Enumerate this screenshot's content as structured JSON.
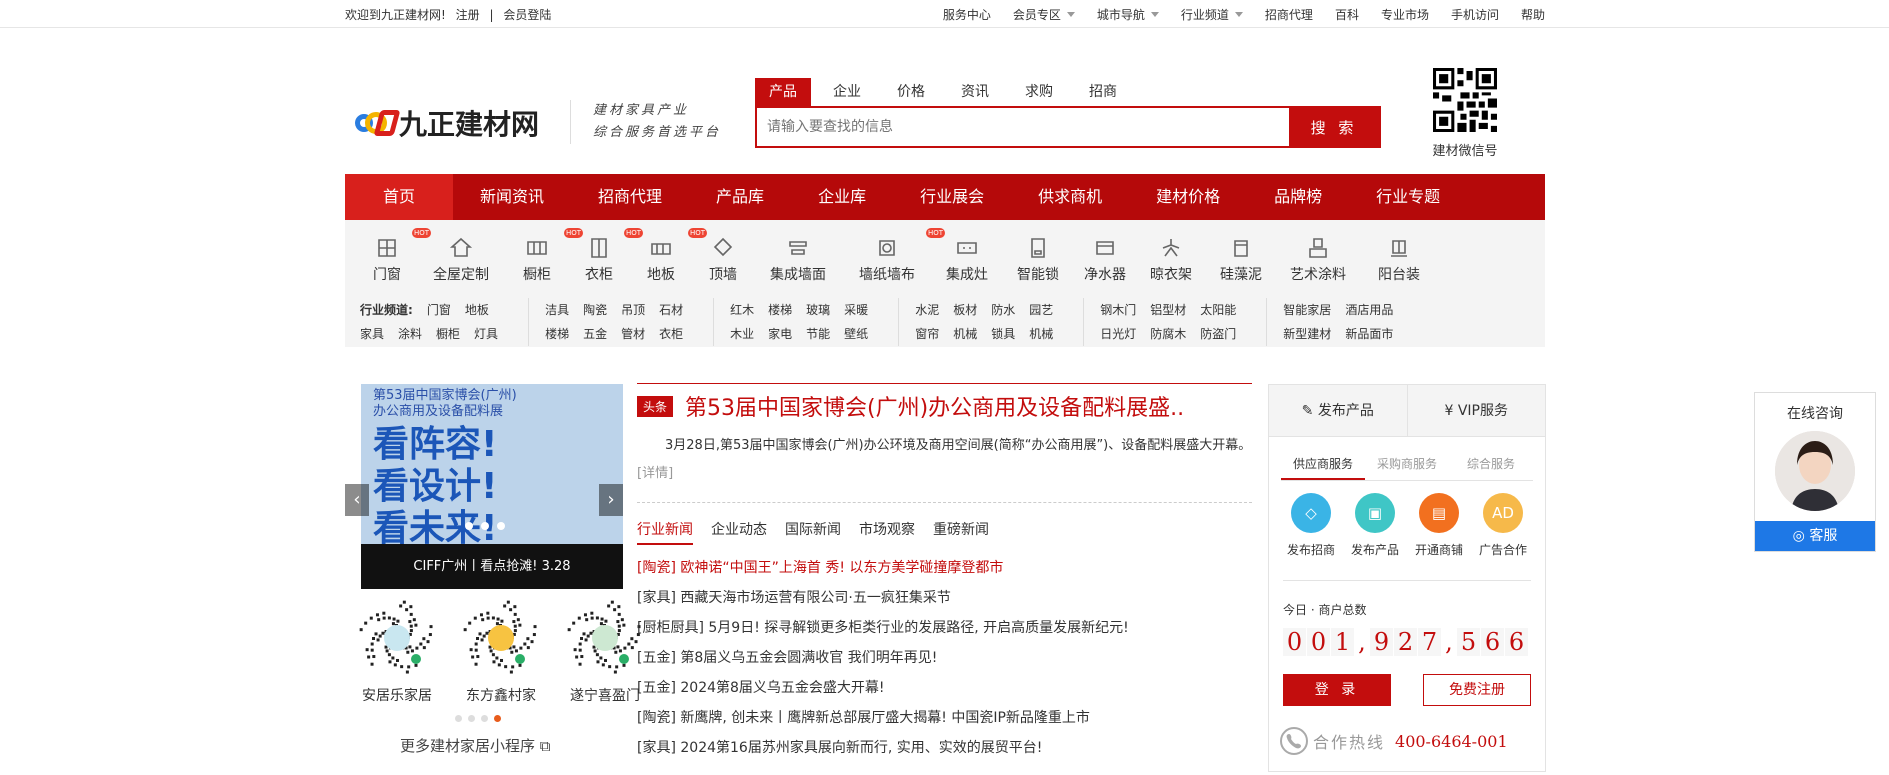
{
  "topbar": {
    "welcome": "欢迎到九正建材网!",
    "register": "注册",
    "login": "会员登陆",
    "links": [
      {
        "label": "服务中心",
        "caret": false
      },
      {
        "label": "会员专区",
        "caret": true
      },
      {
        "label": "城市导航",
        "caret": true
      },
      {
        "label": "行业频道",
        "caret": true
      },
      {
        "label": "招商代理",
        "caret": false
      },
      {
        "label": "百科",
        "caret": false
      },
      {
        "label": "专业市场",
        "caret": false
      },
      {
        "label": "手机访问",
        "caret": false
      },
      {
        "label": "帮助",
        "caret": false
      }
    ]
  },
  "header": {
    "logo": "九正建材网",
    "slogan1": "建材家具产业",
    "slogan2": "综合服务首选平台",
    "qr_label": "建材微信号"
  },
  "search": {
    "tabs": [
      "产品",
      "企业",
      "价格",
      "资讯",
      "求购",
      "招商"
    ],
    "placeholder": "请输入要查找的信息",
    "button": "搜 索"
  },
  "nav": [
    "首页",
    "新闻资讯",
    "招商代理",
    "产品库",
    "企业库",
    "行业展会",
    "供求商机",
    "建材价格",
    "品牌榜",
    "行业专题"
  ],
  "categories": [
    {
      "label": "门窗",
      "hot": true
    },
    {
      "label": "全屋定制",
      "hot": false
    },
    {
      "label": "橱柜",
      "hot": true
    },
    {
      "label": "衣柜",
      "hot": true
    },
    {
      "label": "地板",
      "hot": true
    },
    {
      "label": "顶墙",
      "hot": false
    },
    {
      "label": "集成墙面",
      "hot": false
    },
    {
      "label": "墙纸墙布",
      "hot": true
    },
    {
      "label": "集成灶",
      "hot": false
    },
    {
      "label": "智能锁",
      "hot": false
    },
    {
      "label": "净水器",
      "hot": false
    },
    {
      "label": "晾衣架",
      "hot": false
    },
    {
      "label": "硅藻泥",
      "hot": false
    },
    {
      "label": "艺术涂料",
      "hot": false
    },
    {
      "label": "阳台装",
      "hot": false
    }
  ],
  "hot_label": "HOT",
  "channels": {
    "title": "行业频道:",
    "groups": [
      {
        "r1": [
          "门窗",
          "地板"
        ],
        "r2": [
          "家具",
          "涂料",
          "橱柜",
          "灯具"
        ]
      },
      {
        "r1": [
          "洁具",
          "陶瓷",
          "吊顶",
          "石材"
        ],
        "r2": [
          "楼梯",
          "五金",
          "管材",
          "衣柜"
        ]
      },
      {
        "r1": [
          "红木",
          "楼梯",
          "玻璃",
          "采暖"
        ],
        "r2": [
          "木业",
          "家电",
          "节能",
          "壁纸"
        ]
      },
      {
        "r1": [
          "水泥",
          "板材",
          "防水",
          "园艺"
        ],
        "r2": [
          "窗帘",
          "机械",
          "锁具",
          "机械"
        ]
      },
      {
        "r1": [
          "钢木门",
          "铝型材",
          "太阳能"
        ],
        "r2": [
          "日光灯",
          "防腐木",
          "防盗门"
        ]
      },
      {
        "r1": [
          "智能家居",
          "酒店用品"
        ],
        "r2": [
          "新型建材",
          "新品面市"
        ]
      }
    ]
  },
  "banner": {
    "title1": "第53届中国家博会(广州)",
    "title2": "办公商用及设备配料展",
    "big1": "看阵容!",
    "big2": "看设计!",
    "big3": "看未来!",
    "caption": "CIFF广州丨看点抢滩! 3.28",
    "prev": "‹",
    "next": "›"
  },
  "miniprograms": [
    {
      "name": "安居乐家居"
    },
    {
      "name": "东方鑫村家"
    },
    {
      "name": "遂宁喜盈门"
    }
  ],
  "more_mp": "更多建材家居小程序 ⧉",
  "headline": {
    "tag": "头条",
    "title": "第53届中国家博会(广州)办公商用及设备配料展盛..",
    "summary": "3月28日,第53届中国家博会(广州)办公环境及商用空间展(简称“办公商用展”)、设备配料展盛大开幕。",
    "detail": "[详情]"
  },
  "news_tabs": [
    "行业新闻",
    "企业动态",
    "国际新闻",
    "市场观察",
    "重磅新闻"
  ],
  "news": [
    {
      "text": "[陶瓷] 欧神诺“中国王”上海首 秀! 以东方美学碰撞摩登都市",
      "red": true
    },
    {
      "text": "[家具] 西藏天海市场运营有限公司·五一疯狂集采节",
      "red": false
    },
    {
      "text": "[厨柜厨具] 5月9日! 探寻解锁更多柜类行业的发展路径, 开启高质量发展新纪元!",
      "red": false
    },
    {
      "text": "[五金] 第8届义乌五金会圆满收官 我们明年再见!",
      "red": false
    },
    {
      "text": "[五金] 2024第8届义乌五金会盛大开幕!",
      "red": false
    },
    {
      "text": "[陶瓷] 新鹰牌, 创未来丨鹰牌新总部展厅盛大揭幕! 中国瓷IP新品隆重上市",
      "red": false
    },
    {
      "text": "[家具] 2024第16届苏州家具展向新而行, 实用、实效的展贸平台!",
      "red": false
    }
  ],
  "side": {
    "publish": "发布产品",
    "vip": "VIP服务",
    "tabs": [
      "供应商服务",
      "采购商服务",
      "综合服务"
    ],
    "services": [
      {
        "label": "发布招商",
        "color": "#3ab4e6",
        "icon": "◇"
      },
      {
        "label": "发布产品",
        "color": "#3fc6c6",
        "icon": "▣"
      },
      {
        "label": "开通商铺",
        "color": "#f2701f",
        "icon": "▤"
      },
      {
        "label": "广告合作",
        "color": "#f6b94a",
        "icon": "AD"
      }
    ],
    "count_label": "今日 · 商户总数",
    "digits": [
      "0",
      "0",
      "1",
      ",",
      "9",
      "2",
      "7",
      ",",
      "5",
      "6",
      "6"
    ],
    "login": "登 录",
    "register": "免费注册",
    "hotline_label": "合作热线",
    "hotline": "400-6464-001"
  },
  "consult": {
    "title": "在线咨询",
    "button": "客服"
  }
}
